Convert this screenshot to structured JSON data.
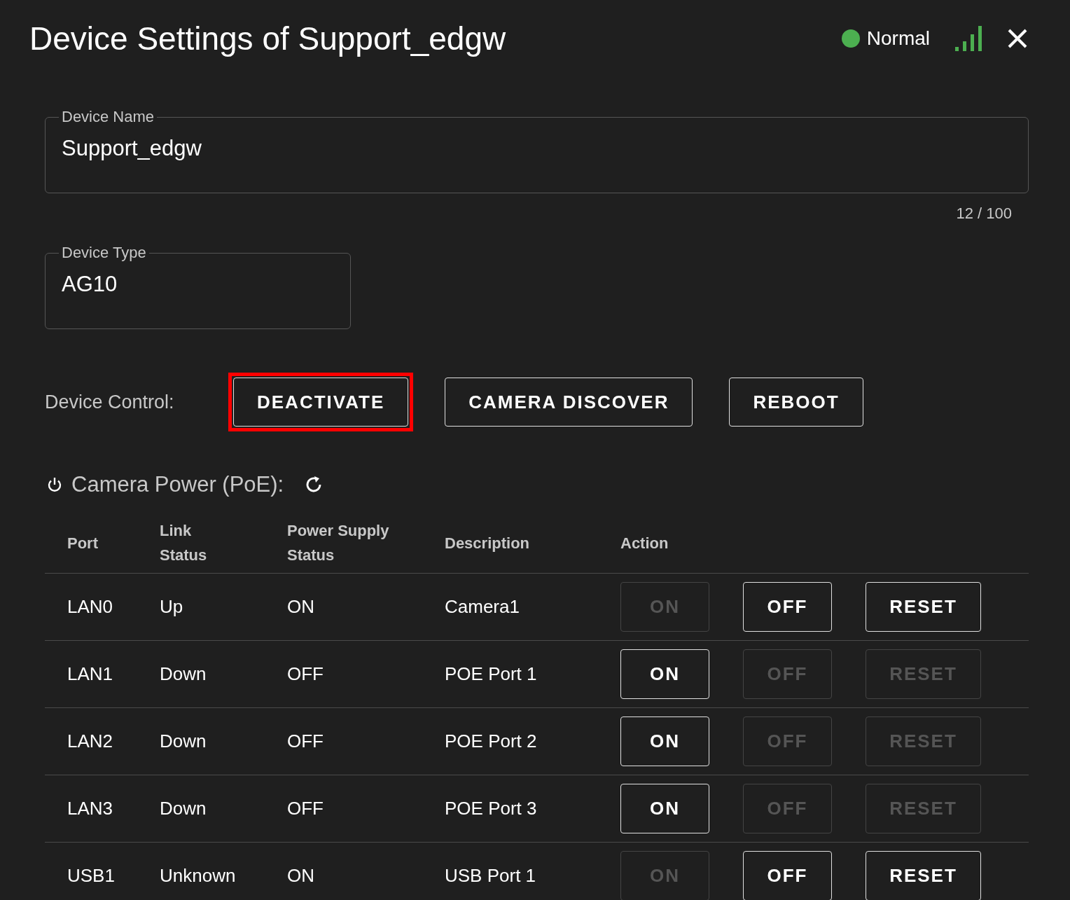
{
  "window": {
    "title": "Device Settings of Support_edgw",
    "status": {
      "label": "Normal",
      "color": "#4caf50"
    }
  },
  "fields": [
    {
      "label": "Device Name",
      "value": "Support_edgw",
      "counter": "12 / 100",
      "wide": true
    },
    {
      "label": "Device Type",
      "value": "AG10",
      "wide": false
    }
  ],
  "device_control": {
    "label": "Device Control:",
    "buttons": [
      {
        "label": "DEACTIVATE",
        "highlighted": true
      },
      {
        "label": "CAMERA DISCOVER",
        "highlighted": false
      },
      {
        "label": "REBOOT",
        "highlighted": false
      }
    ]
  },
  "camera_power": {
    "title": "Camera Power (PoE):",
    "columns": [
      "Port",
      "Link Status",
      "Power Supply Status",
      "Description",
      "Action"
    ],
    "rows": [
      {
        "port": "LAN0",
        "link": "Up",
        "power": "ON",
        "description": "Camera1",
        "actions": [
          {
            "label": "ON",
            "disabled": true
          },
          {
            "label": "OFF",
            "disabled": false
          },
          {
            "label": "RESET",
            "disabled": false
          }
        ]
      },
      {
        "port": "LAN1",
        "link": "Down",
        "power": "OFF",
        "description": "POE Port 1",
        "actions": [
          {
            "label": "ON",
            "disabled": false
          },
          {
            "label": "OFF",
            "disabled": true
          },
          {
            "label": "RESET",
            "disabled": true
          }
        ]
      },
      {
        "port": "LAN2",
        "link": "Down",
        "power": "OFF",
        "description": "POE Port 2",
        "actions": [
          {
            "label": "ON",
            "disabled": false
          },
          {
            "label": "OFF",
            "disabled": true
          },
          {
            "label": "RESET",
            "disabled": true
          }
        ]
      },
      {
        "port": "LAN3",
        "link": "Down",
        "power": "OFF",
        "description": "POE Port 3",
        "actions": [
          {
            "label": "ON",
            "disabled": false
          },
          {
            "label": "OFF",
            "disabled": true
          },
          {
            "label": "RESET",
            "disabled": true
          }
        ]
      },
      {
        "port": "USB1",
        "link": "Unknown",
        "power": "ON",
        "description": "USB Port 1",
        "actions": [
          {
            "label": "ON",
            "disabled": true
          },
          {
            "label": "OFF",
            "disabled": false
          },
          {
            "label": "RESET",
            "disabled": false
          }
        ]
      }
    ]
  }
}
